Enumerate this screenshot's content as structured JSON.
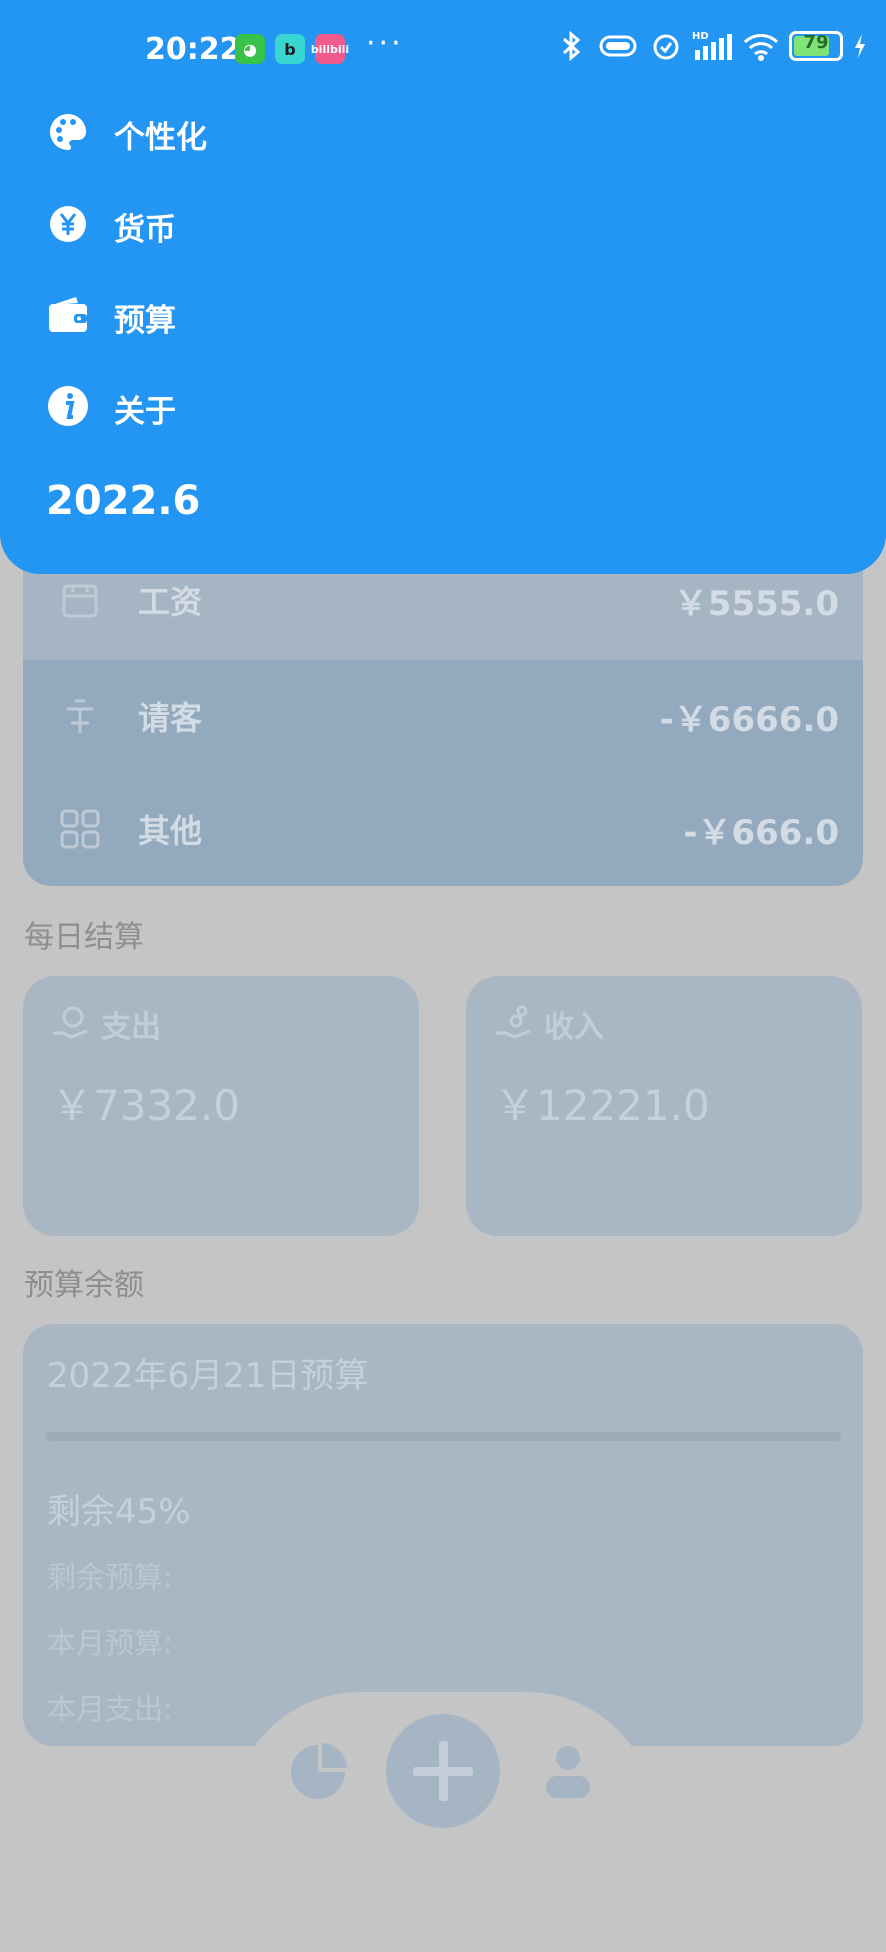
{
  "status_bar": {
    "time": "20:22",
    "apps": [
      "cat-app-icon",
      "b-app-icon",
      "bilibili-app-icon"
    ],
    "bilibili_label": "bilibili",
    "more": "···",
    "battery": "79",
    "hd_label": "HD"
  },
  "drawer": {
    "menu": [
      {
        "label": "个性化",
        "icon": "palette-icon"
      },
      {
        "label": "货币",
        "icon": "yen-icon"
      },
      {
        "label": "预算",
        "icon": "wallet-icon"
      },
      {
        "label": "关于",
        "icon": "info-icon"
      }
    ],
    "version": "2022.6",
    "accent": "#2395f3"
  },
  "transactions": [
    {
      "label": "工资",
      "amount": "￥5555.0",
      "icon": "calendar-icon"
    },
    {
      "label": "请客",
      "amount": "-￥6666.0",
      "icon": "guest-icon"
    },
    {
      "label": "其他",
      "amount": "-￥666.0",
      "icon": "grid-icon"
    }
  ],
  "daily": {
    "title": "每日结算",
    "expense": {
      "label": "支出",
      "value": "￥7332.0",
      "icon": "money-hand-icon"
    },
    "income": {
      "label": "收入",
      "value": "￥12221.0",
      "icon": "coins-hand-icon"
    }
  },
  "budget": {
    "title": "预算余额",
    "card_title": "2022年6月21日预算",
    "remaining_pct": "剩余45%",
    "remaining_fraction": 0.45,
    "remaining_label": "剩余预算:",
    "monthly_label": "本月预算:",
    "spent_label": "本月支出:"
  },
  "bottom_nav": {
    "items": [
      "pie-chart-icon",
      "add-icon",
      "user-icon"
    ]
  }
}
